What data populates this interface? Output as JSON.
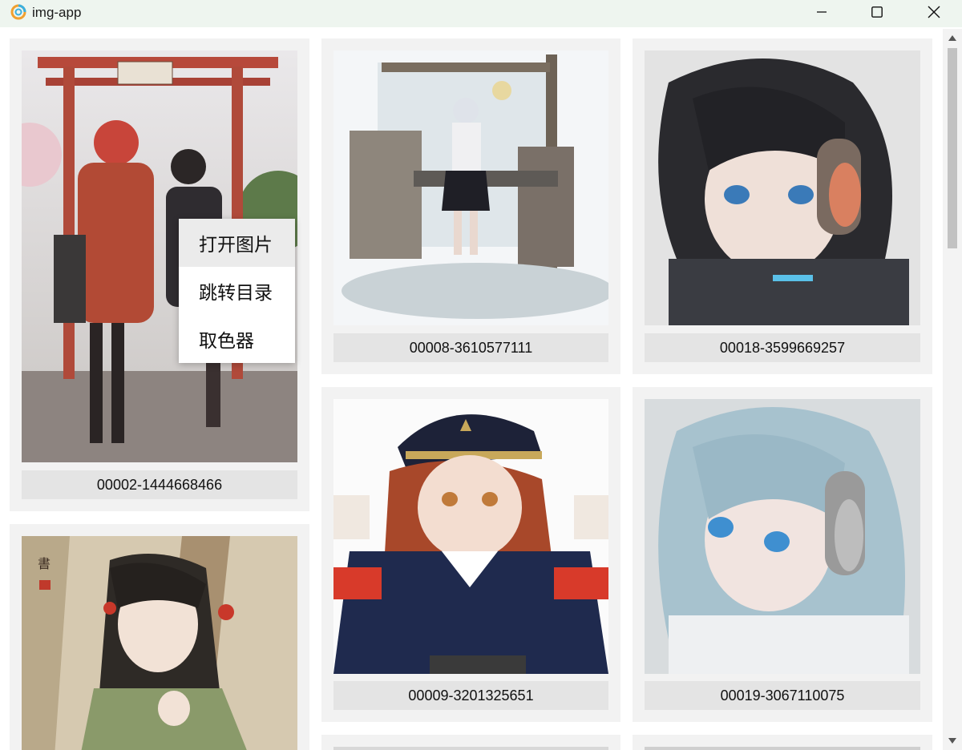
{
  "window": {
    "title": "img-app",
    "icon": "app-swirl-icon",
    "controls": [
      "minimize-icon",
      "maximize-icon",
      "close-icon"
    ]
  },
  "gallery": {
    "items": [
      {
        "caption": "00002-1444668466",
        "image": "two anime girls at torii gate"
      },
      {
        "caption": "00008-3610577111",
        "image": "anime girl in ruined shop with water"
      },
      {
        "caption": "00018-3599669257",
        "image": "dark haired girl with headphones"
      },
      {
        "caption": "00009-3201325651",
        "image": "red haired girl in navy cap and uniform"
      },
      {
        "caption": "00019-3067110075",
        "image": "silver haired girl with headphones"
      },
      {
        "caption": "",
        "image": "girl in green robe with flowers in hair"
      }
    ]
  },
  "context_menu": {
    "items": [
      {
        "label": "打开图片",
        "hover": true
      },
      {
        "label": "跳转目录",
        "hover": false
      },
      {
        "label": "取色器",
        "hover": false
      }
    ]
  },
  "colors": {
    "titlebar_bg": "#eef5ef",
    "card_bg": "#f2f2f2",
    "caption_bg": "#e4e4e4",
    "menu_hover": "#ebebeb"
  }
}
